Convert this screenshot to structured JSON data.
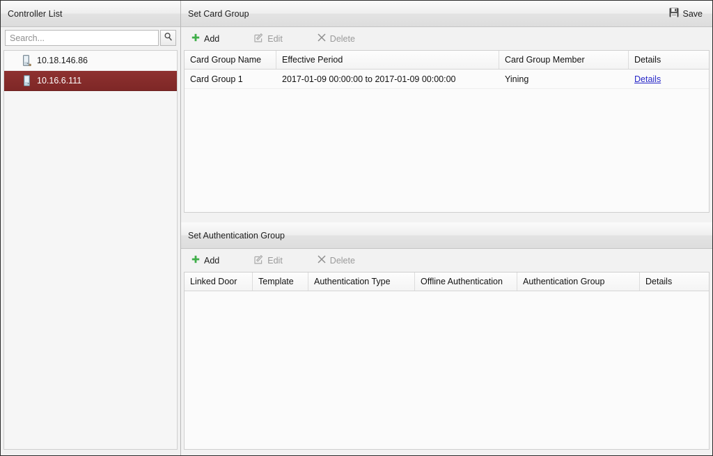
{
  "left_panel": {
    "title": "Controller List",
    "search": {
      "placeholder": "Search...",
      "value": "",
      "button_icon": "search-icon"
    },
    "items": [
      {
        "label": "10.18.146.86",
        "icon": "controller-device-icon",
        "selected": false
      },
      {
        "label": "10.16.6.111",
        "icon": "controller-device-icon",
        "selected": true
      }
    ]
  },
  "card_group_section": {
    "title": "Set Card Group",
    "save_label": "Save",
    "save_icon": "floppy-save-icon",
    "toolbar": {
      "add_label": "Add",
      "add_icon": "plus-icon",
      "edit_label": "Edit",
      "edit_icon": "pencil-edit-icon",
      "delete_label": "Delete",
      "delete_icon": "x-close-icon"
    },
    "columns": [
      "Card Group Name",
      "Effective Period",
      "Card Group Member",
      "Details"
    ],
    "rows": [
      {
        "name": "Card Group 1",
        "period": "2017-01-09 00:00:00 to 2017-01-09 00:00:00",
        "member": "Yining",
        "details": "Details"
      }
    ]
  },
  "auth_group_section": {
    "title": "Set Authentication Group",
    "toolbar": {
      "add_label": "Add",
      "add_icon": "plus-icon",
      "edit_label": "Edit",
      "edit_icon": "pencil-edit-icon",
      "delete_label": "Delete",
      "delete_icon": "x-close-icon"
    },
    "columns": [
      "Linked Door",
      "Template",
      "Authentication Type",
      "Offline Authentication",
      "Authentication Group",
      "Details"
    ],
    "rows": []
  },
  "colors": {
    "selection": "#8e3130",
    "link": "#2727c8",
    "add_green": "#3fae49",
    "panel_bg": "#f2f2f2"
  }
}
